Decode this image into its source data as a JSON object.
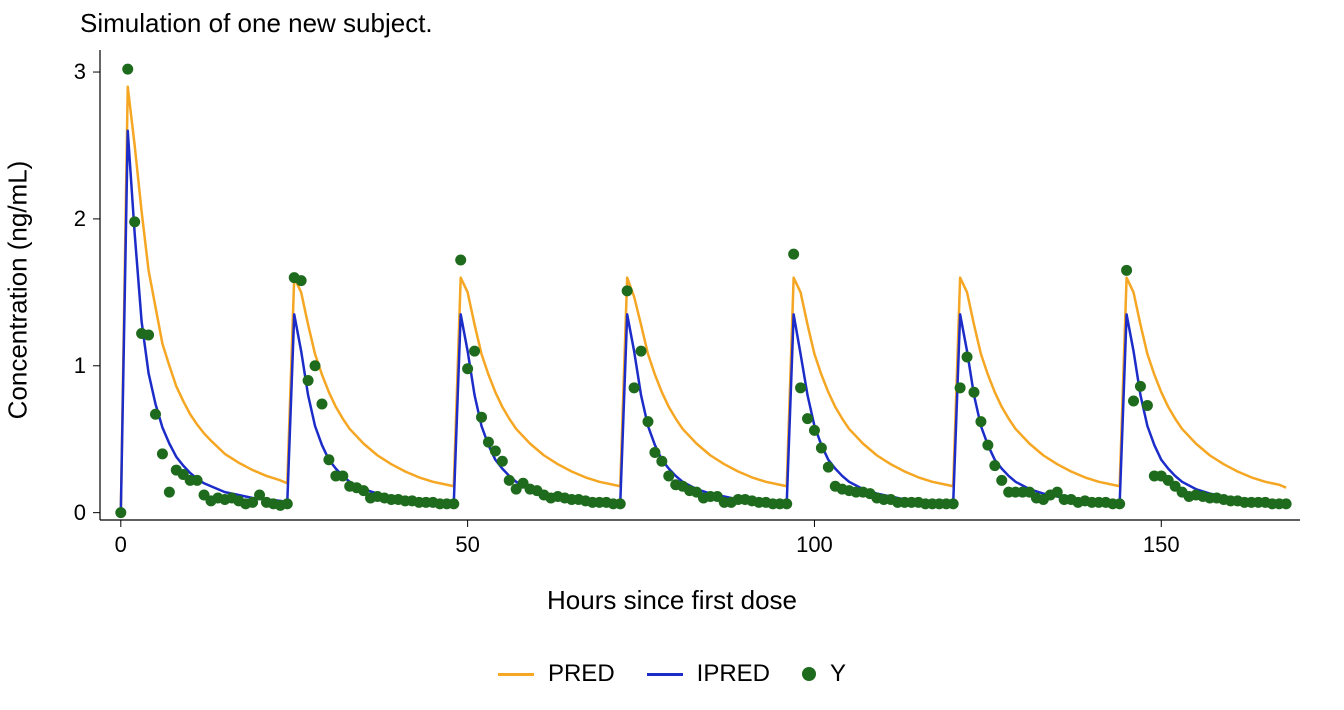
{
  "chart_data": {
    "type": "line",
    "title": "Simulation of one new subject.",
    "xlabel": "Hours since first dose",
    "ylabel": "Concentration (ng/mL)",
    "xlim": [
      -3,
      170
    ],
    "ylim": [
      -0.05,
      3.15
    ],
    "xticks": [
      0,
      50,
      100,
      150
    ],
    "yticks": [
      0,
      1,
      2,
      3
    ],
    "series_line": [
      {
        "name": "PRED",
        "color": "#F5A623",
        "x": [
          0,
          1,
          2,
          3,
          4,
          5,
          6,
          7,
          8,
          9,
          10,
          11,
          12,
          13,
          15,
          17,
          19,
          21,
          23,
          24,
          25,
          26,
          27,
          28,
          29,
          30,
          31,
          32,
          33,
          35,
          37,
          39,
          41,
          43,
          45,
          47,
          48,
          49,
          50,
          51,
          52,
          53,
          54,
          55,
          56,
          57,
          59,
          61,
          63,
          65,
          67,
          69,
          71,
          72,
          73,
          74,
          75,
          76,
          77,
          78,
          79,
          80,
          81,
          83,
          85,
          87,
          89,
          91,
          93,
          95,
          96,
          97,
          98,
          99,
          100,
          101,
          102,
          103,
          104,
          105,
          107,
          109,
          111,
          113,
          115,
          117,
          119,
          120,
          121,
          122,
          123,
          124,
          125,
          126,
          127,
          128,
          129,
          131,
          133,
          135,
          137,
          139,
          141,
          143,
          144,
          145,
          146,
          147,
          148,
          149,
          150,
          151,
          152,
          153,
          155,
          157,
          159,
          161,
          163,
          165,
          167,
          168
        ],
        "values": [
          0,
          2.9,
          2.5,
          2.05,
          1.65,
          1.4,
          1.15,
          1.0,
          0.86,
          0.76,
          0.67,
          0.6,
          0.54,
          0.49,
          0.4,
          0.34,
          0.29,
          0.25,
          0.22,
          0.2,
          1.6,
          1.5,
          1.28,
          1.08,
          0.94,
          0.82,
          0.72,
          0.64,
          0.57,
          0.47,
          0.39,
          0.33,
          0.28,
          0.24,
          0.21,
          0.19,
          0.18,
          1.6,
          1.5,
          1.28,
          1.08,
          0.94,
          0.82,
          0.72,
          0.64,
          0.57,
          0.47,
          0.39,
          0.33,
          0.28,
          0.24,
          0.21,
          0.19,
          0.18,
          1.6,
          1.47,
          1.28,
          1.08,
          0.94,
          0.82,
          0.72,
          0.64,
          0.57,
          0.47,
          0.39,
          0.33,
          0.28,
          0.24,
          0.21,
          0.19,
          0.18,
          1.6,
          1.5,
          1.28,
          1.08,
          0.94,
          0.82,
          0.72,
          0.64,
          0.57,
          0.47,
          0.39,
          0.33,
          0.28,
          0.24,
          0.21,
          0.19,
          0.18,
          1.6,
          1.5,
          1.28,
          1.08,
          0.94,
          0.82,
          0.72,
          0.64,
          0.57,
          0.47,
          0.39,
          0.33,
          0.28,
          0.24,
          0.21,
          0.19,
          0.18,
          1.6,
          1.5,
          1.28,
          1.08,
          0.94,
          0.82,
          0.72,
          0.64,
          0.57,
          0.47,
          0.39,
          0.33,
          0.28,
          0.24,
          0.21,
          0.19,
          0.17
        ]
      },
      {
        "name": "IPRED",
        "color": "#1C2CC8",
        "x": [
          0,
          1,
          2,
          3,
          4,
          5,
          6,
          7,
          8,
          9,
          10,
          11,
          12,
          13,
          15,
          17,
          19,
          21,
          23,
          24,
          25,
          26,
          27,
          28,
          29,
          30,
          31,
          32,
          33,
          35,
          37,
          39,
          41,
          43,
          45,
          47,
          48,
          49,
          50,
          51,
          52,
          53,
          54,
          55,
          56,
          57,
          59,
          61,
          63,
          65,
          67,
          69,
          71,
          72,
          73,
          74,
          75,
          76,
          77,
          78,
          79,
          80,
          81,
          83,
          85,
          87,
          89,
          91,
          93,
          95,
          96,
          97,
          98,
          99,
          100,
          101,
          102,
          103,
          104,
          105,
          107,
          109,
          111,
          113,
          115,
          117,
          119,
          120,
          121,
          122,
          123,
          124,
          125,
          126,
          127,
          128,
          129,
          131,
          133,
          135,
          137,
          139,
          141,
          143,
          144,
          145,
          146,
          147,
          148,
          149,
          150,
          151,
          152,
          153,
          155,
          157,
          159,
          161,
          163,
          165,
          167,
          168
        ],
        "values": [
          0,
          2.6,
          1.9,
          1.3,
          0.95,
          0.74,
          0.58,
          0.47,
          0.38,
          0.32,
          0.27,
          0.23,
          0.2,
          0.18,
          0.14,
          0.12,
          0.1,
          0.09,
          0.08,
          0.07,
          1.35,
          1.1,
          0.8,
          0.59,
          0.46,
          0.36,
          0.3,
          0.25,
          0.21,
          0.16,
          0.13,
          0.11,
          0.09,
          0.08,
          0.07,
          0.07,
          0.06,
          1.35,
          1.1,
          0.8,
          0.59,
          0.46,
          0.36,
          0.3,
          0.25,
          0.21,
          0.16,
          0.13,
          0.11,
          0.09,
          0.08,
          0.07,
          0.07,
          0.06,
          1.35,
          1.1,
          0.8,
          0.59,
          0.46,
          0.36,
          0.3,
          0.25,
          0.21,
          0.16,
          0.13,
          0.11,
          0.09,
          0.08,
          0.07,
          0.07,
          0.06,
          1.35,
          1.08,
          0.8,
          0.59,
          0.46,
          0.36,
          0.3,
          0.25,
          0.21,
          0.16,
          0.13,
          0.11,
          0.09,
          0.08,
          0.07,
          0.07,
          0.06,
          1.35,
          1.1,
          0.8,
          0.59,
          0.46,
          0.36,
          0.3,
          0.25,
          0.21,
          0.16,
          0.13,
          0.11,
          0.09,
          0.08,
          0.07,
          0.07,
          0.06,
          1.35,
          1.1,
          0.8,
          0.59,
          0.46,
          0.36,
          0.3,
          0.25,
          0.21,
          0.16,
          0.13,
          0.11,
          0.09,
          0.08,
          0.07,
          0.07,
          0.06
        ]
      }
    ],
    "series_points": {
      "name": "Y",
      "color": "#1E6B1E",
      "x": [
        0,
        1,
        2,
        3,
        4,
        5,
        6,
        7,
        8,
        9,
        10,
        11,
        12,
        13,
        14,
        15,
        16,
        17,
        18,
        19,
        20,
        21,
        22,
        23,
        24,
        25,
        26,
        27,
        28,
        29,
        30,
        31,
        32,
        33,
        34,
        35,
        36,
        37,
        38,
        39,
        40,
        41,
        42,
        43,
        44,
        45,
        46,
        47,
        48,
        49,
        50,
        51,
        52,
        53,
        54,
        55,
        56,
        57,
        58,
        59,
        60,
        61,
        62,
        63,
        64,
        65,
        66,
        67,
        68,
        69,
        70,
        71,
        72,
        73,
        74,
        75,
        76,
        77,
        78,
        79,
        80,
        81,
        82,
        83,
        84,
        85,
        86,
        87,
        88,
        89,
        90,
        91,
        92,
        93,
        94,
        95,
        96,
        97,
        98,
        99,
        100,
        101,
        102,
        103,
        104,
        105,
        106,
        107,
        108,
        109,
        110,
        111,
        112,
        113,
        114,
        115,
        116,
        117,
        118,
        119,
        120,
        121,
        122,
        123,
        124,
        125,
        126,
        127,
        128,
        129,
        130,
        131,
        132,
        133,
        134,
        135,
        136,
        137,
        138,
        139,
        140,
        141,
        142,
        143,
        144,
        145,
        146,
        147,
        148,
        149,
        150,
        151,
        152,
        153,
        154,
        155,
        156,
        157,
        158,
        159,
        160,
        161,
        162,
        163,
        164,
        165,
        166,
        167,
        168
      ],
      "values": [
        0.0,
        3.02,
        1.98,
        1.22,
        1.21,
        0.67,
        0.4,
        0.14,
        0.29,
        0.26,
        0.22,
        0.22,
        0.12,
        0.08,
        0.1,
        0.09,
        0.1,
        0.08,
        0.06,
        0.07,
        0.12,
        0.07,
        0.06,
        0.05,
        0.06,
        1.6,
        1.58,
        0.9,
        1.0,
        0.74,
        0.36,
        0.25,
        0.25,
        0.18,
        0.17,
        0.15,
        0.1,
        0.11,
        0.1,
        0.09,
        0.09,
        0.08,
        0.08,
        0.07,
        0.07,
        0.07,
        0.06,
        0.06,
        0.06,
        1.72,
        0.98,
        1.1,
        0.65,
        0.48,
        0.42,
        0.35,
        0.22,
        0.16,
        0.2,
        0.16,
        0.15,
        0.12,
        0.1,
        0.11,
        0.1,
        0.09,
        0.09,
        0.08,
        0.07,
        0.07,
        0.07,
        0.06,
        0.06,
        1.51,
        0.85,
        1.1,
        0.62,
        0.41,
        0.35,
        0.25,
        0.19,
        0.18,
        0.15,
        0.14,
        0.1,
        0.11,
        0.11,
        0.07,
        0.07,
        0.09,
        0.09,
        0.08,
        0.07,
        0.07,
        0.06,
        0.06,
        0.06,
        1.76,
        0.85,
        0.64,
        0.56,
        0.44,
        0.31,
        0.18,
        0.16,
        0.15,
        0.14,
        0.14,
        0.13,
        0.1,
        0.09,
        0.09,
        0.07,
        0.07,
        0.07,
        0.07,
        0.06,
        0.06,
        0.06,
        0.06,
        0.06,
        0.85,
        1.06,
        0.82,
        0.62,
        0.46,
        0.32,
        0.22,
        0.14,
        0.14,
        0.14,
        0.14,
        0.1,
        0.09,
        0.12,
        0.14,
        0.09,
        0.09,
        0.07,
        0.08,
        0.07,
        0.07,
        0.07,
        0.06,
        0.06,
        1.65,
        0.76,
        0.86,
        0.73,
        0.25,
        0.25,
        0.22,
        0.18,
        0.14,
        0.11,
        0.12,
        0.11,
        0.1,
        0.1,
        0.09,
        0.08,
        0.08,
        0.07,
        0.07,
        0.07,
        0.07,
        0.06,
        0.06,
        0.06
      ]
    },
    "legend": [
      {
        "type": "line",
        "name": "PRED",
        "color": "#F5A623"
      },
      {
        "type": "line",
        "name": "IPRED",
        "color": "#1C2CC8"
      },
      {
        "type": "point",
        "name": "Y",
        "color": "#1E6B1E"
      }
    ]
  }
}
